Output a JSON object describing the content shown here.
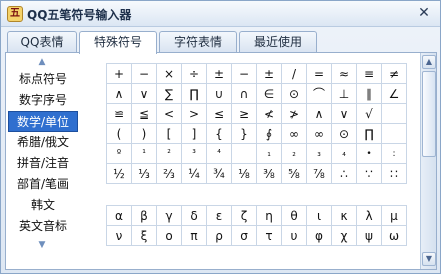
{
  "window": {
    "title": "QQ五笔符号输入器",
    "app_icon_glyph": "五",
    "close_glyph": "✕"
  },
  "tabs": [
    {
      "label": "QQ表情",
      "active": false
    },
    {
      "label": "特殊符号",
      "active": true
    },
    {
      "label": "字符表情",
      "active": false
    },
    {
      "label": "最近使用",
      "active": false
    }
  ],
  "sidebar": {
    "up_arrow": "▲",
    "down_arrow": "▼",
    "items": [
      {
        "label": "标点符号",
        "active": false
      },
      {
        "label": "数字序号",
        "active": false
      },
      {
        "label": "数学/单位",
        "active": true
      },
      {
        "label": "希腊/俄文",
        "active": false
      },
      {
        "label": "拼音/注音",
        "active": false
      },
      {
        "label": "部首/笔画",
        "active": false
      },
      {
        "label": "韩文",
        "active": false
      },
      {
        "label": "英文音标",
        "active": false
      }
    ]
  },
  "math_symbols": [
    [
      "+",
      "−",
      "×",
      "÷",
      "±",
      "−",
      "±",
      "/",
      "=",
      "≈",
      "≡",
      "≠"
    ],
    [
      "∧",
      "∨",
      "∑",
      "∏",
      "∪",
      "∩",
      "∈",
      "⊙",
      "⌒",
      "⊥",
      "∥",
      "∠"
    ],
    [
      "≌",
      "≦",
      "<",
      ">",
      "≤",
      "≥",
      "≮",
      "≯",
      "∧",
      "∨",
      "√",
      ""
    ],
    [
      "(",
      ")",
      "[",
      "]",
      "{",
      "}",
      "∮",
      "∞",
      "∞",
      "⊙",
      "∏",
      ""
    ],
    [
      "º",
      "¹",
      "²",
      "³",
      "⁴",
      "",
      "₁",
      "₂",
      "₃",
      "₄",
      "•",
      ":"
    ],
    [
      "½",
      "⅓",
      "⅔",
      "¼",
      "¾",
      "⅛",
      "⅜",
      "⅝",
      "⅞",
      "∴",
      "∵",
      "∷"
    ]
  ],
  "greek_symbols": [
    [
      "α",
      "β",
      "γ",
      "δ",
      "ε",
      "ζ",
      "η",
      "θ",
      "ι",
      "κ",
      "λ",
      "μ"
    ],
    [
      "ν",
      "ξ",
      "ο",
      "π",
      "ρ",
      "σ",
      "τ",
      "υ",
      "φ",
      "χ",
      "ψ",
      "ω"
    ]
  ],
  "scrollbar": {
    "up_arrow": "▲",
    "down_arrow": "▼"
  }
}
